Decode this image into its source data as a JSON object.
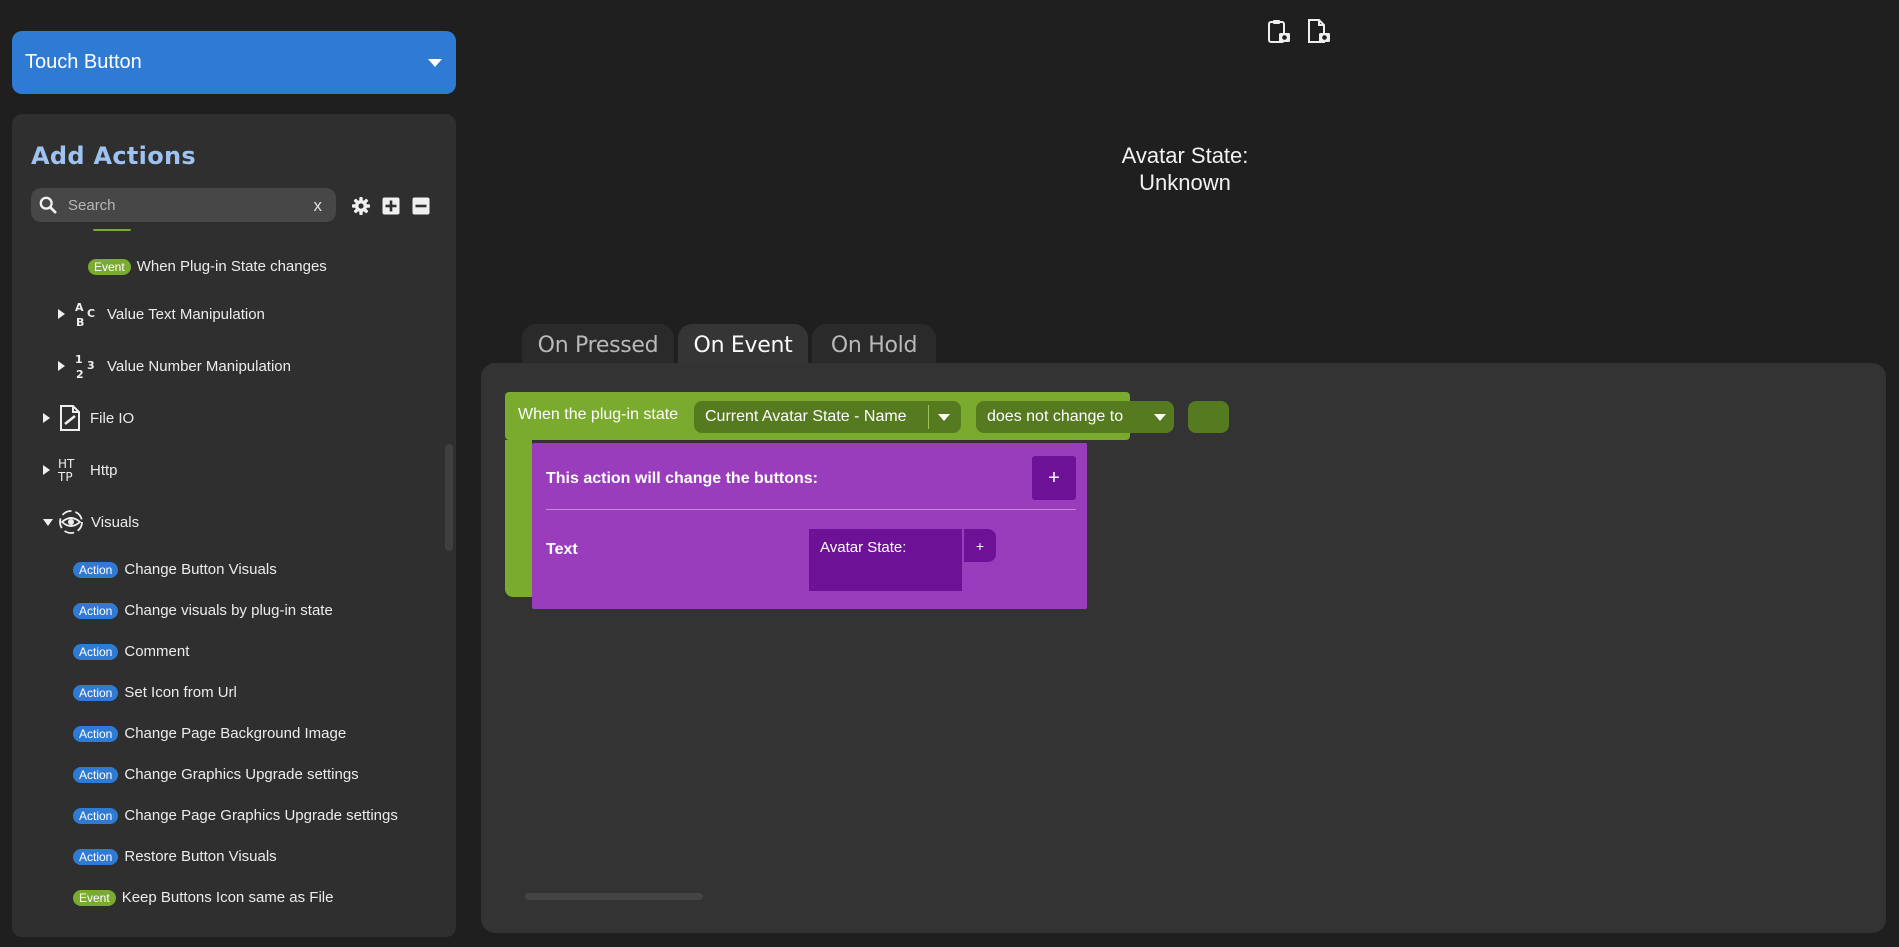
{
  "type_select": {
    "label": "Touch Button"
  },
  "panel": {
    "title": "Add Actions",
    "search": {
      "placeholder": "Search",
      "clear_label": "x"
    },
    "tools": [
      "gear-icon",
      "expand-all-icon",
      "collapse-all-icon"
    ],
    "tree": [
      {
        "kind": "event",
        "badge": "Event",
        "label": "When Plug-in State changes"
      },
      {
        "kind": "category",
        "label": "Value Text Manipulation",
        "icon": "abc-icon"
      },
      {
        "kind": "category",
        "label": "Value Number Manipulation",
        "icon": "numbers-icon"
      },
      {
        "kind": "category",
        "label": "File IO",
        "icon": "file-icon"
      },
      {
        "kind": "category",
        "label": "Http",
        "icon": "http-icon"
      },
      {
        "kind": "category",
        "label": "Visuals",
        "icon": "eye-icon",
        "expanded": true
      },
      {
        "kind": "action",
        "badge": "Action",
        "label": "Change Button Visuals"
      },
      {
        "kind": "action",
        "badge": "Action",
        "label": "Change visuals by plug-in state"
      },
      {
        "kind": "action",
        "badge": "Action",
        "label": "Comment"
      },
      {
        "kind": "action",
        "badge": "Action",
        "label": "Set Icon from Url"
      },
      {
        "kind": "action",
        "badge": "Action",
        "label": "Change Page Background Image"
      },
      {
        "kind": "action",
        "badge": "Action",
        "label": "Change Graphics Upgrade settings"
      },
      {
        "kind": "action",
        "badge": "Action",
        "label": "Change Page Graphics Upgrade settings"
      },
      {
        "kind": "action",
        "badge": "Action",
        "label": "Restore Button Visuals"
      },
      {
        "kind": "event",
        "badge": "Event",
        "label": "Keep Buttons Icon same as File"
      }
    ]
  },
  "header_icons": [
    "paste-clipboard-icon",
    "file-screenshot-icon"
  ],
  "preview": {
    "line1": "Avatar State:",
    "line2": "Unknown"
  },
  "tabs": [
    {
      "label": "On Pressed",
      "active": false
    },
    {
      "label": "On Event",
      "active": true
    },
    {
      "label": "On Hold",
      "active": false
    }
  ],
  "event_block": {
    "label": "When the plug-in state",
    "state_value": "Current Avatar State - Name",
    "condition_value": "does not change to",
    "compare_value": ""
  },
  "action_block": {
    "title": "This action will change the buttons:",
    "add_label": "+",
    "field_label": "Text",
    "field_value": "Avatar State:",
    "field_add_label": "+"
  },
  "colors": {
    "accent": "#2f7bd4",
    "event_green": "#7aaa2e",
    "action_purple": "#9a3dbd",
    "action_purple_dark": "#6d1297",
    "panel_bg": "#2f2f2f",
    "title_blue": "#9ec3f0"
  }
}
